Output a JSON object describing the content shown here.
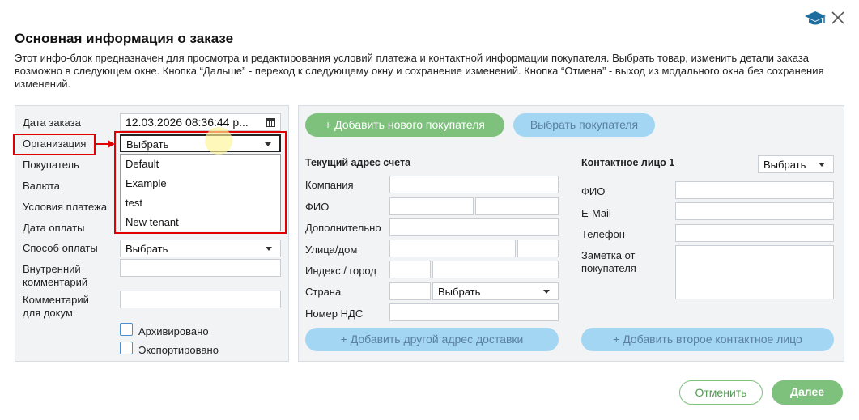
{
  "header": {
    "title": "Основная информация о заказе",
    "description": "Этот инфо-блок предназначен для просмотра и редактирования условий платежа и контактной информации покупателя. Выбрать товар, изменить детали заказа возможно в следующем окне. Кнопка “Дальше” - переход к следующему окну и сохранение изменений. Кнопка “Отмена” - выход из модального окна без сохранения изменений."
  },
  "left": {
    "order_date_label": "Дата заказа",
    "order_date_value": "12.03.2026 08:36:44 p...",
    "organization_label": "Организация",
    "organization_selected": "Выбрать",
    "organization_options": [
      "Default",
      "Example",
      "test",
      "New tenant"
    ],
    "buyer_label": "Покупатель",
    "currency_label": "Валюта",
    "payment_terms_label": "Условия платежа",
    "payment_date_label": "Дата оплаты",
    "payment_method_label": "Способ оплаты",
    "payment_method_selected": "Выбрать",
    "internal_comment_label_1": "Внутренний",
    "internal_comment_label_2": "комментарий",
    "doc_comment_label_1": "Комментарий",
    "doc_comment_label_2": "для докум.",
    "archived_label": "Архивировано",
    "exported_label": "Экспортировано"
  },
  "right": {
    "add_buyer_button": "+ Добавить нового покупателя",
    "choose_buyer_button": "Выбрать покупателя",
    "billing": {
      "title": "Текущий адрес счета",
      "company_label": "Компания",
      "fio_label": "ФИО",
      "additional_label": "Дополнительно",
      "street_label": "Улица/дом",
      "zip_city_label": "Индекс / город",
      "country_label": "Страна",
      "country_selected": "Выбрать",
      "vat_label": "Номер НДС",
      "add_delivery_button": "+ Добавить другой адрес доставки"
    },
    "contact": {
      "title": "Контактное лицо 1",
      "select_value": "Выбрать",
      "fio_label": "ФИО",
      "email_label": "E-Mail",
      "phone_label": "Телефон",
      "note_label_1": "Заметка от",
      "note_label_2": "покупателя",
      "add_contact_button": "+ Добавить второе контактное лицо"
    }
  },
  "footer": {
    "cancel_button": "Отменить",
    "next_button": "Далее"
  },
  "colors": {
    "accent_green": "#7dc17d",
    "accent_blue": "#a3d6f2",
    "annotation_red": "#e00000"
  },
  "icons": {
    "close": "close-icon",
    "help": "graduation-cap-icon",
    "calendar": "calendar-icon"
  }
}
